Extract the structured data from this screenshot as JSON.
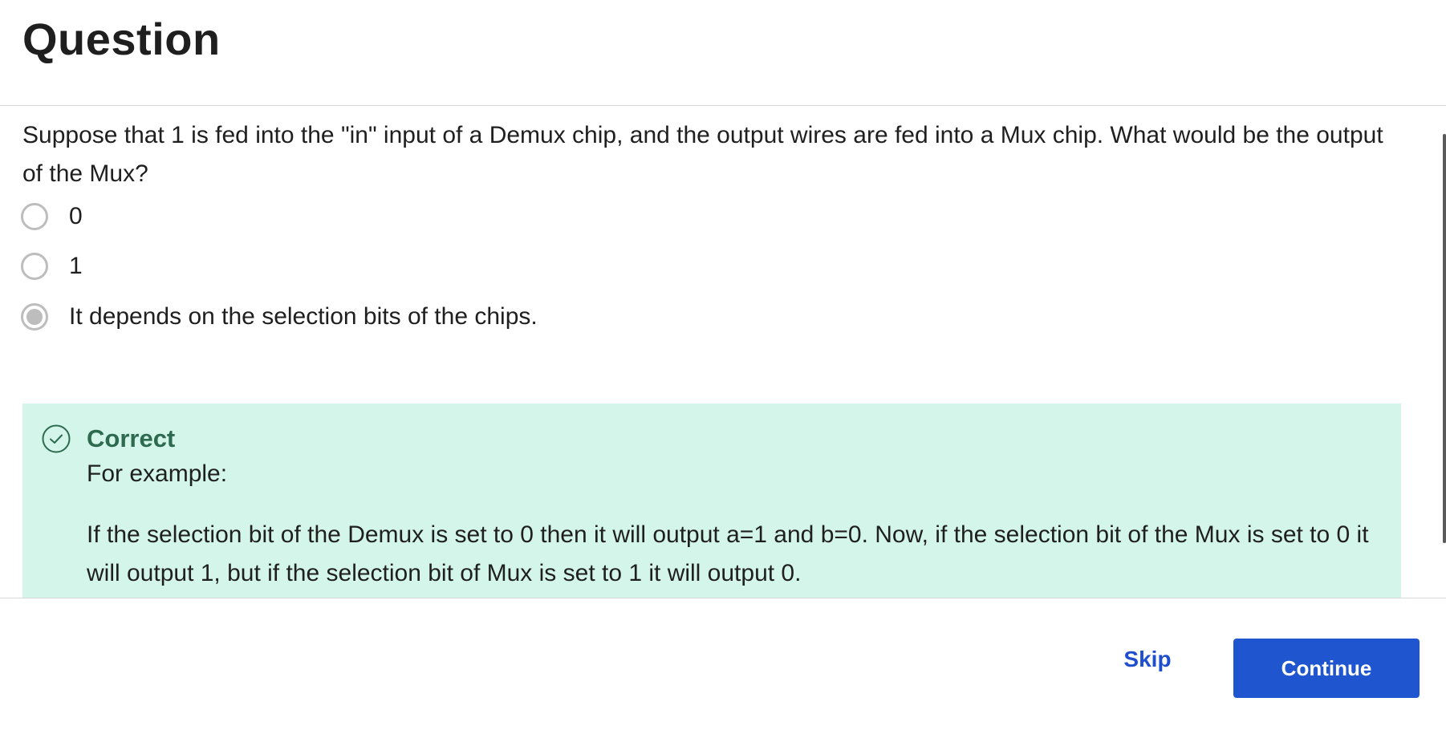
{
  "header": {
    "title": "Question"
  },
  "question": {
    "prompt": "Suppose that 1 is fed into the \"in\" input of a Demux chip, and the output wires are fed into a Mux chip. What would be the output of the Mux?",
    "options": [
      {
        "label": "0",
        "selected": false
      },
      {
        "label": "1",
        "selected": false
      },
      {
        "label": "It depends on the selection bits of the chips.",
        "selected": true
      }
    ]
  },
  "feedback": {
    "status": "Correct",
    "intro": "For example:",
    "explanation": "If the selection bit of the Demux is set to 0 then it will output a=1 and b=0. Now, if the selection bit of the Mux is set to 0 it will output 1, but if the selection bit of Mux is set to 1 it will output 0.",
    "icon": "check-circle-icon",
    "background_color": "#d4f6ea",
    "title_color": "#2d6a4f"
  },
  "footer": {
    "skip_label": "Skip",
    "continue_label": "Continue",
    "accent_color": "#1f55cf"
  }
}
